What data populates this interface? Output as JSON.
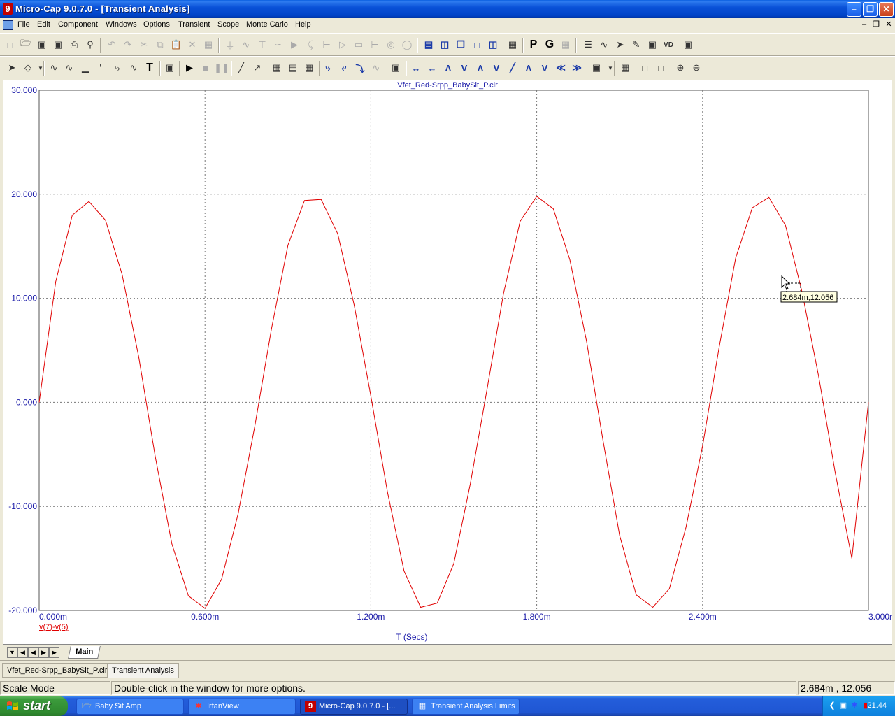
{
  "window": {
    "title": "Micro-Cap 9.0.7.0 - [Transient Analysis]",
    "app_icon": "9"
  },
  "menu": {
    "items": [
      "File",
      "Edit",
      "Component",
      "Windows",
      "Options",
      "Transient",
      "Scope",
      "Monte Carlo",
      "Help"
    ]
  },
  "toolbar2": {
    "text_tool": "T",
    "p_tool": "P",
    "g_tool": "G",
    "vd_tool": "VD"
  },
  "plot": {
    "file_title": "Vfet_Red-Srpp_BabySit_P.cir",
    "curve_label": "v(7)-v(5)",
    "curve_color": "#e00000",
    "axis_text_color": "#1a1aa8",
    "x_title": "T (Secs)",
    "tooltip": "2.684m,12.056",
    "cursor_point": {
      "t_ms": 2.684,
      "v": 12.056
    }
  },
  "chart_data": {
    "type": "line",
    "title": "Vfet_Red-Srpp_BabySit_P.cir",
    "xlabel": "T (Secs)",
    "ylabel": "",
    "x_ticks": [
      "0.000m",
      "0.600m",
      "1.200m",
      "1.800m",
      "2.400m",
      "3.000m"
    ],
    "y_ticks": [
      "30.000",
      "20.000",
      "10.000",
      "0.000",
      "-10.000",
      "-20.000"
    ],
    "xlim_ms": [
      0,
      3
    ],
    "ylim": [
      -20,
      30
    ],
    "grid": true,
    "series": [
      {
        "name": "v(7)-v(5)",
        "color": "#e00000",
        "t_ms": [
          0.0,
          0.06,
          0.12,
          0.18,
          0.24,
          0.3,
          0.36,
          0.42,
          0.48,
          0.54,
          0.6,
          0.66,
          0.72,
          0.78,
          0.84,
          0.9,
          0.96,
          1.02,
          1.08,
          1.14,
          1.2,
          1.26,
          1.32,
          1.38,
          1.44,
          1.5,
          1.56,
          1.62,
          1.68,
          1.74,
          1.8,
          1.86,
          1.92,
          1.98,
          2.04,
          2.1,
          2.16,
          2.22,
          2.28,
          2.34,
          2.4,
          2.46,
          2.52,
          2.58,
          2.64,
          2.7,
          2.76,
          2.82,
          2.88,
          2.94,
          3.0
        ],
        "values": [
          0.0,
          11.6,
          18.0,
          19.3,
          17.5,
          12.3,
          4.4,
          -5.2,
          -13.6,
          -18.6,
          -19.8,
          -17.0,
          -10.7,
          -2.3,
          7.0,
          15.1,
          19.4,
          19.5,
          16.2,
          9.3,
          0.6,
          -8.6,
          -16.2,
          -19.7,
          -19.3,
          -15.5,
          -7.8,
          1.2,
          10.5,
          17.4,
          19.8,
          18.6,
          13.7,
          5.9,
          -3.7,
          -12.8,
          -18.5,
          -19.7,
          -17.9,
          -12.0,
          -4.2,
          5.3,
          13.9,
          18.7,
          19.7,
          17.0,
          10.6,
          2.5,
          -6.8,
          -15.0,
          0.0
        ]
      }
    ]
  },
  "tabs": {
    "main_tab": "Main"
  },
  "doc_tabs": [
    "Vfet_Red-Srpp_BabySit_P.cir",
    "Transient Analysis"
  ],
  "status": {
    "mode": "Scale Mode",
    "hint": "Double-click in the window for more options.",
    "coords": "2.684m , 12.056"
  },
  "taskbar": {
    "start_label": "start",
    "items": [
      "Baby Sit Amp",
      "IrfanView",
      "Micro-Cap 9.0.7.0 - [...",
      "Transient Analysis Limits"
    ],
    "clock": "21.44"
  }
}
